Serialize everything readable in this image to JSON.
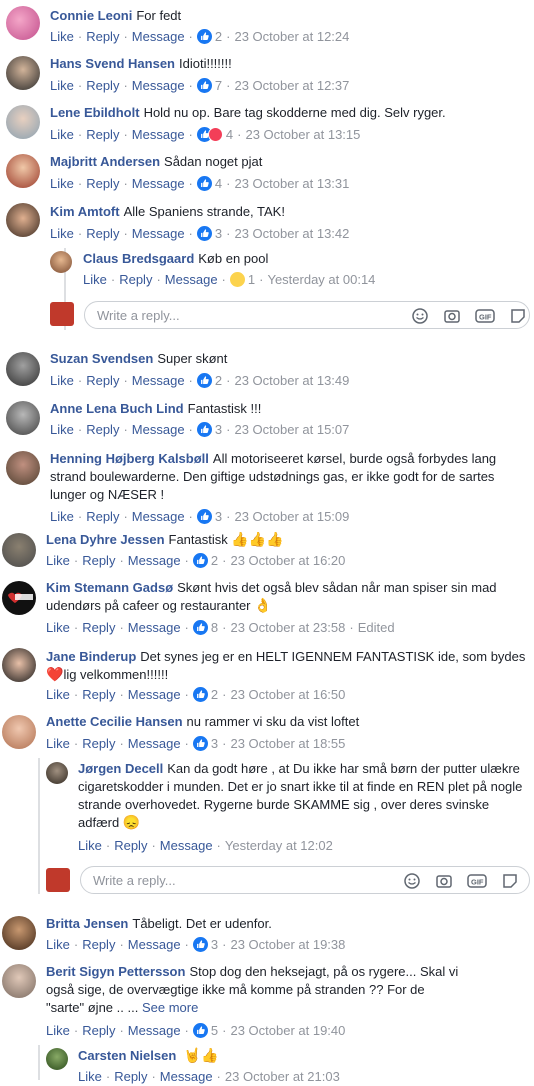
{
  "actions": {
    "like": "Like",
    "reply": "Reply",
    "message": "Message",
    "see_more": "See more",
    "write_reply": "Write a reply...",
    "edited": "Edited"
  },
  "comments": [
    {
      "name": "Connie Leoni",
      "text": "For fedt",
      "count": "2",
      "time": "23 October at 12:24"
    },
    {
      "name": "Hans Svend Hansen",
      "text": "Idioti!!!!!!!",
      "count": "7",
      "time": "23 October at 12:37"
    },
    {
      "name": "Lene Ebildholt",
      "text": "Hold nu op. Bare tag skodderne med dig. Selv ryger.",
      "count": "4",
      "time": "23 October at 13:15"
    },
    {
      "name": "Majbritt Andersen",
      "text": "Sådan noget pjat",
      "count": "4",
      "time": "23 October at 13:31"
    },
    {
      "name": "Kim Amtoft",
      "text": "Alle Spaniens strande, TAK!",
      "count": "3",
      "time": "23 October at 13:42"
    },
    {
      "name": "Claus Bredsgaard",
      "text": "Køb en pool",
      "count": "1",
      "time": "Yesterday at 00:14"
    },
    {
      "name": "Suzan Svendsen",
      "text": "Super skønt",
      "count": "2",
      "time": "23 October at 13:49"
    },
    {
      "name": "Anne Lena Buch Lind",
      "text": "Fantastisk !!!",
      "count": "3",
      "time": "23 October at 15:07"
    },
    {
      "name": "Henning Højberg Kalsbøll",
      "text": "All motoriseeret kørsel, burde også forbydes lang strand boulewarderne. Den giftige udstødnings gas, er ikke godt for de sartes lunger og NÆSER !",
      "count": "3",
      "time": "23 October at 15:09"
    },
    {
      "name": "Lena Dyhre Jessen",
      "text": "Fantastisk",
      "count": "2",
      "time": "23 October at 16:20"
    },
    {
      "name": "Kim Stemann Gadsø",
      "text": "Skønt hvis det også blev sådan når man spiser sin mad udendørs på cafeer og restauranter",
      "count": "8",
      "time": "23 October at 23:58"
    },
    {
      "name": "Jane Binderup",
      "text_a": "Det synes jeg er en HELT IGENNEM FANTASTISK ide, som bydes",
      "text_b": "lig velkommen!!!!!!",
      "count": "2",
      "time": "23 October at 16:50"
    },
    {
      "name": "Anette Cecilie Hansen",
      "text": "nu rammer vi sku da vist loftet",
      "count": "3",
      "time": "23 October at 18:55"
    },
    {
      "name": "Jørgen Decell",
      "text": "Kan da godt høre , at Du ikke har små børn der putter ulækre cigaretskodder i munden. Det er jo snart ikke til at finde en REN plet på nogle strande overhovedet. Rygerne burde SKAMME sig , over deres svinske adfærd",
      "time": "Yesterday at 12:02"
    },
    {
      "name": "Britta Jensen",
      "text": "Tåbeligt. Det er udenfor.",
      "count": "3",
      "time": "23 October at 19:38"
    },
    {
      "name": "Berit Sigyn Pettersson",
      "text": "Stop dog den heksejagt, på os rygere... Skal vi også sige, de overvægtige ikke må komme på stranden ?? For de \"sarte\" øjne .. ...",
      "count": "5",
      "time": "23 October at 19:40"
    },
    {
      "name": "Carsten Nielsen",
      "time": "23 October at 21:03"
    }
  ],
  "colors": {
    "link": "#385898",
    "meta": "#90949c",
    "like_blue": "#1877f2"
  }
}
